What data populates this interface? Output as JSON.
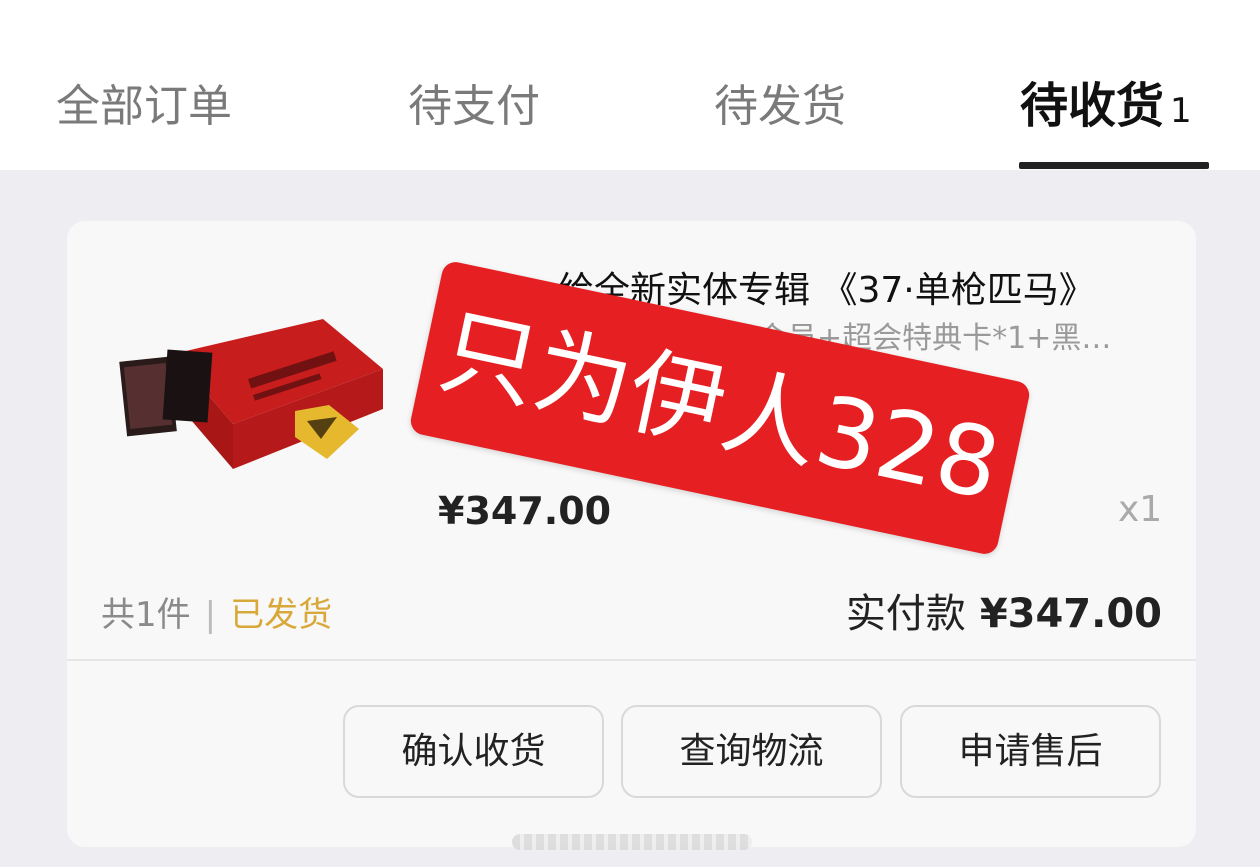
{
  "tabs": [
    {
      "label": "全部订单"
    },
    {
      "label": "待支付"
    },
    {
      "label": "待发货"
    },
    {
      "label": "待收货",
      "count": "1"
    }
  ],
  "order": {
    "title": "…给全新实体专辑 《37·单枪匹马》",
    "subtitle": "超级会员+超会特典卡*1+黑…",
    "price": "¥347.00",
    "quantity": "x1",
    "item_count": "共1件",
    "separator": "|",
    "status": "已发货",
    "paid_label": "实付款",
    "paid_amount": "¥347.00",
    "status_color": "#d8a93a"
  },
  "actions": {
    "confirm": "确认收货",
    "logistics": "查询物流",
    "after_sales": "申请售后"
  },
  "overlay": {
    "stamp_text": "只为伊人328",
    "stamp_color": "#e61f22"
  }
}
